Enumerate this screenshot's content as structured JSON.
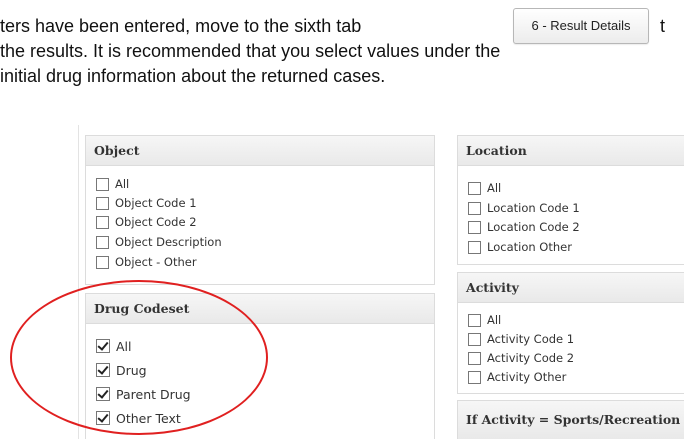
{
  "intro": {
    "line1_text": "ters have been entered, move to the sixth tab",
    "tab_button_label": "6 - Result Details",
    "line1_tail": "t",
    "line2_text": "the results. It is recommended that you select values under the",
    "line3_text": "initial drug information about the returned cases."
  },
  "panels": {
    "object": {
      "title": "Object",
      "options": [
        {
          "label": "All",
          "checked": false
        },
        {
          "label": "Object Code 1",
          "checked": false
        },
        {
          "label": "Object Code 2",
          "checked": false
        },
        {
          "label": "Object Description",
          "checked": false
        },
        {
          "label": "Object - Other",
          "checked": false
        }
      ]
    },
    "drug_codeset": {
      "title": "Drug Codeset",
      "options": [
        {
          "label": "All",
          "checked": true
        },
        {
          "label": "Drug",
          "checked": true
        },
        {
          "label": "Parent Drug",
          "checked": true
        },
        {
          "label": "Other Text",
          "checked": true
        }
      ]
    },
    "location": {
      "title": "Location",
      "options": [
        {
          "label": "All",
          "checked": false
        },
        {
          "label": "Location Code 1",
          "checked": false
        },
        {
          "label": "Location Code 2",
          "checked": false
        },
        {
          "label": "Location Other",
          "checked": false
        }
      ]
    },
    "activity": {
      "title": "Activity",
      "options": [
        {
          "label": "All",
          "checked": false
        },
        {
          "label": "Activity Code 1",
          "checked": false
        },
        {
          "label": "Activity Code 2",
          "checked": false
        },
        {
          "label": "Activity Other",
          "checked": false
        }
      ]
    },
    "sports": {
      "title": "If Activity = Sports/Recreation"
    }
  },
  "colors": {
    "highlight_ellipse": "#e02020"
  }
}
